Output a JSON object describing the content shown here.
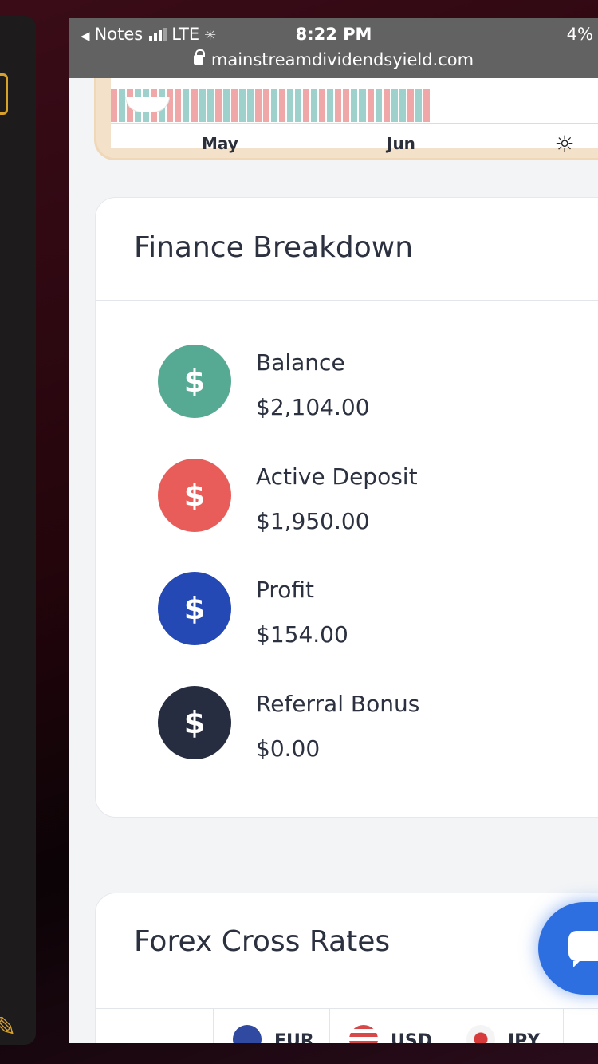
{
  "status_bar": {
    "back_app": "Notes",
    "network": "LTE",
    "time": "8:22 PM",
    "battery": "4%",
    "url": "mainstreamdividendsyield.com"
  },
  "chart_card": {
    "x_ticks": [
      "May",
      "Jun"
    ]
  },
  "finance_breakdown": {
    "title": "Finance Breakdown",
    "items": [
      {
        "label": "Balance",
        "value": "$2,104.00",
        "color": "#56a992",
        "icon": "$"
      },
      {
        "label": "Active Deposit",
        "value": "$1,950.00",
        "color": "#e85d5a",
        "icon": "$"
      },
      {
        "label": "Profit",
        "value": "$154.00",
        "color": "#2448b4",
        "icon": "$"
      },
      {
        "label": "Referral Bonus",
        "value": "$0.00",
        "color": "#262d40",
        "icon": "$"
      }
    ]
  },
  "forex": {
    "title": "Forex Cross Rates",
    "columns": [
      "EUR",
      "USD",
      "JPY"
    ]
  },
  "colors": {
    "bar_red": "#f0a7a7",
    "bar_teal": "#9fd1cc",
    "chat_button": "#2d6fe0"
  }
}
